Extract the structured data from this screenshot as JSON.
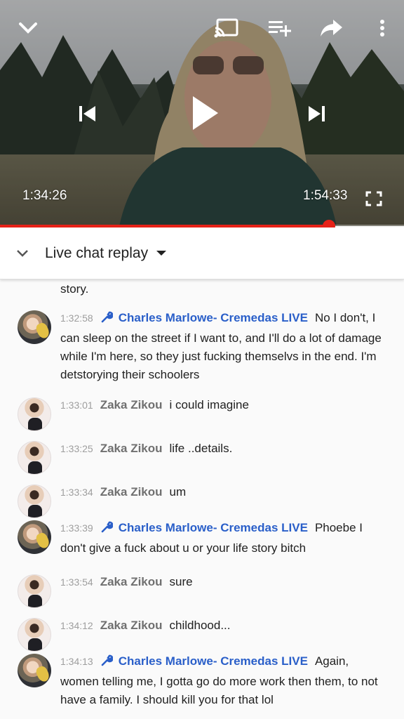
{
  "player": {
    "current_time": "1:34:26",
    "duration": "1:54:33",
    "progress": 0.815,
    "accent_color": "#e62117"
  },
  "icons": {
    "minimize": "chevron-down-icon",
    "cast": "cast-icon",
    "add_to_queue": "playlist-add-icon",
    "share": "share-icon",
    "more": "more-vert-icon",
    "previous": "skip-previous-icon",
    "play": "play-icon",
    "next": "skip-next-icon",
    "fullscreen": "fullscreen-icon",
    "moderator": "wrench-icon"
  },
  "chat": {
    "header_title": "Live chat replay",
    "truncated_text": "story.",
    "owner_color": "#2a5fc9",
    "messages": [
      {
        "time": "1:32:58",
        "author": "Charles Marlowe- Cremedas LIVE",
        "owner": true,
        "text": "No I don't, I can sleep on the street if I want to, and I'll do a lot of damage while I'm here, so they just fucking themselvs in the end. I'm detstorying their schoolers"
      },
      {
        "time": "1:33:01",
        "author": "Zaka Zikou",
        "owner": false,
        "text": "i could imagine"
      },
      {
        "time": "1:33:25",
        "author": "Zaka Zikou",
        "owner": false,
        "text": "life ..details."
      },
      {
        "time": "1:33:34",
        "author": "Zaka Zikou",
        "owner": false,
        "text": "um"
      },
      {
        "time": "1:33:39",
        "author": "Charles Marlowe- Cremedas LIVE",
        "owner": true,
        "text": "Phoebe I don't give a fuck about u or your life story bitch"
      },
      {
        "time": "1:33:54",
        "author": "Zaka Zikou",
        "owner": false,
        "text": "sure"
      },
      {
        "time": "1:34:12",
        "author": "Zaka Zikou",
        "owner": false,
        "text": "childhood..."
      },
      {
        "time": "1:34:13",
        "author": "Charles Marlowe- Cremedas LIVE",
        "owner": true,
        "text": "Again, women telling me, I gotta go do more work then them, to not have a family. I should kill you for that lol"
      }
    ]
  }
}
